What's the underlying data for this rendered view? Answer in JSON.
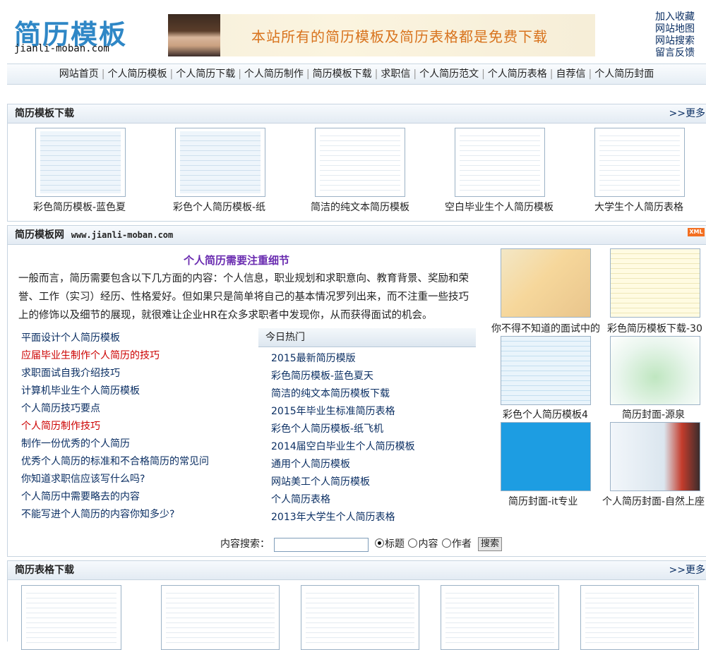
{
  "header": {
    "logo_cn": "简历模板",
    "logo_en": "jianli-moban.com",
    "banner_text": "本站所有的简历模板及简历表格都是免费下载",
    "top_links": [
      "加入收藏",
      "网站地图",
      "网站搜索",
      "留言反馈"
    ]
  },
  "nav": {
    "items": [
      "网站首页",
      "个人简历模板",
      "个人简历下载",
      "个人简历制作",
      "简历模板下载",
      "求职信",
      "个人简历范文",
      "个人简历表格",
      "自荐信",
      "个人简历封面"
    ]
  },
  "section1": {
    "title": "简历模板下载",
    "more": ">>更多",
    "items": [
      "彩色简历模板-蓝色夏",
      "彩色个人简历模板-纸",
      "简洁的纯文本简历模板",
      "空白毕业生个人简历模板",
      "大学生个人简历表格"
    ]
  },
  "section2": {
    "title": "简历模板网",
    "url": "www.jianli-moban.com",
    "badge": "XML",
    "article_title": "个人简历需要注重细节",
    "article_body": "一般而言，简历需要包含以下几方面的内容：个人信息，职业规划和求职意向、教育背景、奖励和荣誉、工作（实习）经历、性格爱好。但如果只是简单将自己的基本情况罗列出来，而不注重一些技巧上的修饰以及细节的展现，就很难让企业HR在众多求职者中发现你，从而获得面试的机会。",
    "left_links": [
      {
        "text": "平面设计个人简历模板",
        "red": false
      },
      {
        "text": "应届毕业生制作个人简历的技巧",
        "red": true
      },
      {
        "text": "求职面试自我介绍技巧",
        "red": false
      },
      {
        "text": "计算机毕业生个人简历模板",
        "red": false
      },
      {
        "text": "个人简历技巧要点",
        "red": false
      },
      {
        "text": "个人简历制作技巧",
        "red": true
      },
      {
        "text": "制作一份优秀的个人简历",
        "red": false
      },
      {
        "text": "优秀个人简历的标准和不合格简历的常见问",
        "red": false
      },
      {
        "text": "你知道求职信应该写什么吗?",
        "red": false
      },
      {
        "text": "个人简历中需要略去的内容",
        "red": false
      },
      {
        "text": "不能写进个人简历的内容你知多少?",
        "red": false
      }
    ],
    "hot_title": "今日热门",
    "hot_links": [
      "2015最新简历模版",
      "彩色简历模板-蓝色夏天",
      "简洁的纯文本简历模板下载",
      "2015年毕业生标准简历表格",
      "彩色个人简历模板-纸飞机",
      "2014届空白毕业生个人简历模板",
      "通用个人简历模板",
      "网站美工个人简历模板",
      "个人简历表格",
      "2013年大学生个人简历表格"
    ],
    "pics": [
      "你不得不知道的面试中的",
      "彩色简历模板下载-30",
      "彩色个人简历模板4",
      "简历封面-源泉",
      "简历封面-it专业",
      "个人简历封面-自然上座"
    ]
  },
  "search": {
    "label": "内容搜索：",
    "value": "",
    "options": [
      "标题",
      "内容",
      "作者"
    ],
    "button": "搜索"
  },
  "section3": {
    "title": "简历表格下载",
    "more": ">>更多"
  }
}
